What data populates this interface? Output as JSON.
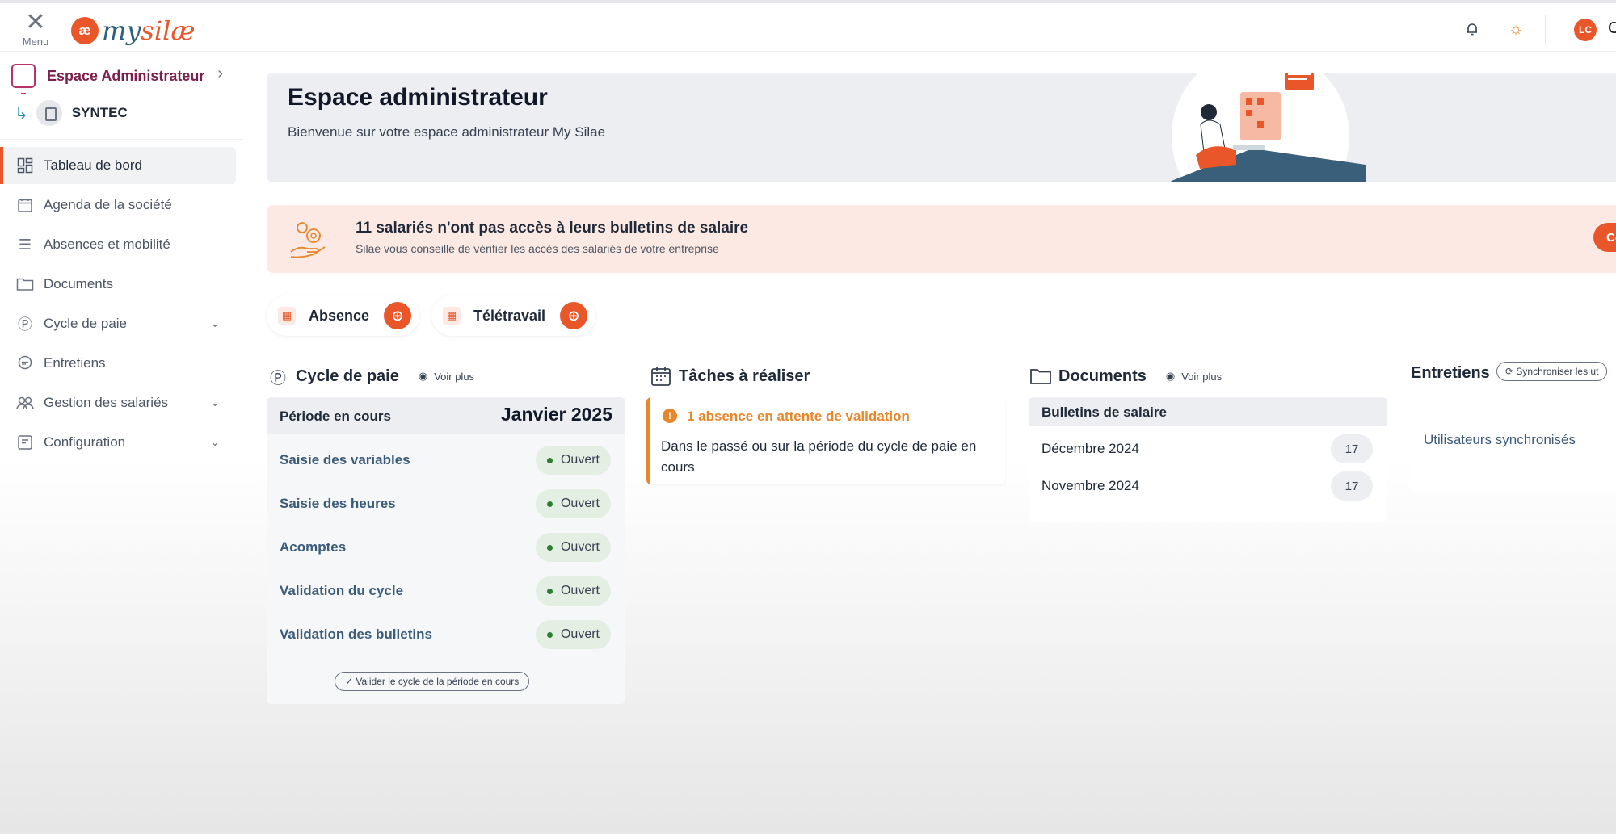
{
  "topbar": {
    "menu_label": "Menu",
    "logo_mark": "æ",
    "logo_my": "my",
    "logo_silae": "silæ",
    "avatar_initials": "LC",
    "avatar_tail": "C",
    "icons": [
      "bell-icon",
      "sun-icon"
    ]
  },
  "sidebar": {
    "admin_label": "Espace Administrateur",
    "company_label": "SYNTEC",
    "items": [
      {
        "label": "Tableau de bord",
        "icon": "dashboard-icon",
        "active": true
      },
      {
        "label": "Agenda de la société",
        "icon": "calendar-icon"
      },
      {
        "label": "Absences et mobilité",
        "icon": "list-icon"
      },
      {
        "label": "Documents",
        "icon": "folder-icon"
      },
      {
        "label": "Cycle de paie",
        "icon": "payroll-icon",
        "expandable": true
      },
      {
        "label": "Entretiens",
        "icon": "chat-icon"
      },
      {
        "label": "Gestion des salariés",
        "icon": "people-icon",
        "expandable": true
      },
      {
        "label": "Configuration",
        "icon": "config-icon",
        "expandable": true
      }
    ]
  },
  "hero": {
    "title": "Espace administrateur",
    "subtitle": "Bienvenue sur votre espace administrateur My Silae"
  },
  "alert": {
    "title": "11 salariés n'ont pas accès à leurs bulletins de salaire",
    "subtitle": "Silae vous conseille de vérifier les accès des salariés de votre entreprise",
    "button": "Configu"
  },
  "quick_actions": [
    {
      "label": "Absence"
    },
    {
      "label": "Télétravail"
    }
  ],
  "cycle": {
    "title": "Cycle de paie",
    "voir_plus": "Voir plus",
    "period_label": "Période en cours",
    "period_value": "Janvier 2025",
    "rows": [
      {
        "label": "Saisie des variables",
        "status": "Ouvert"
      },
      {
        "label": "Saisie des heures",
        "status": "Ouvert"
      },
      {
        "label": "Acomptes",
        "status": "Ouvert"
      },
      {
        "label": "Validation du cycle",
        "status": "Ouvert"
      },
      {
        "label": "Validation des bulletins",
        "status": "Ouvert"
      }
    ],
    "validate_button": "Valider le cycle de la période en cours"
  },
  "tasks": {
    "title": "Tâches à réaliser",
    "item_title": "1 absence en attente de validation",
    "item_desc": "Dans le passé ou sur la période du cycle de paie en cours"
  },
  "documents": {
    "title": "Documents",
    "voir_plus": "Voir plus",
    "header": "Bulletins de salaire",
    "rows": [
      {
        "label": "Décembre 2024",
        "count": "17"
      },
      {
        "label": "Novembre 2024",
        "count": "17"
      }
    ]
  },
  "entretiens": {
    "title": "Entretiens",
    "sync_button": "Synchroniser les ut",
    "link": "Utilisateurs synchronisés"
  },
  "colors": {
    "accent": "#e8562a",
    "brand_dark": "#7b1f4c",
    "link": "#3b5b7a",
    "status_green": "#2e7d32"
  }
}
